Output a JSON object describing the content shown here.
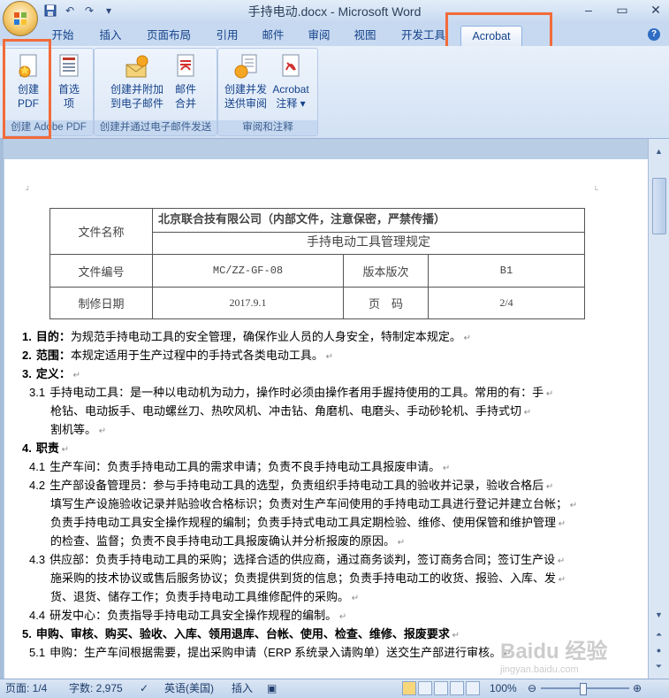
{
  "window": {
    "title": "手持电动.docx - Microsoft Word"
  },
  "quick_access": [
    "save-icon",
    "undo-icon",
    "redo-icon",
    "customize-icon"
  ],
  "tabs": [
    {
      "label": "开始"
    },
    {
      "label": "插入"
    },
    {
      "label": "页面布局"
    },
    {
      "label": "引用"
    },
    {
      "label": "邮件"
    },
    {
      "label": "审阅"
    },
    {
      "label": "视图"
    },
    {
      "label": "开发工具"
    },
    {
      "label": "Acrobat",
      "active": true
    }
  ],
  "ribbon": {
    "groups": [
      {
        "label": "创建 Adobe PDF",
        "buttons": [
          {
            "label1": "创建",
            "label2": "PDF"
          },
          {
            "label1": "首选",
            "label2": "项"
          }
        ]
      },
      {
        "label": "创建并通过电子邮件发送",
        "buttons": [
          {
            "label1": "创建并附加",
            "label2": "到电子邮件"
          },
          {
            "label1": "邮件",
            "label2": "合并"
          }
        ]
      },
      {
        "label": "审阅和注释",
        "buttons": [
          {
            "label1": "创建并发",
            "label2": "送供审阅"
          },
          {
            "label1": "Acrobat",
            "label2": "注释 ▾"
          }
        ]
      }
    ]
  },
  "doc": {
    "header_table": {
      "file_name_label": "文件名称",
      "company": "北京联合技有限公司（内部文件，注意保密，严禁传播）",
      "doc_title": "手持电动工具管理规定",
      "file_no_label": "文件编号",
      "file_no": "MC/ZZ-GF-08",
      "version_label": "版本版次",
      "version": "B1",
      "date_label": "制修日期",
      "date": "2017.9.1",
      "page_label": "页　码",
      "page": "2/4"
    },
    "lines": [
      {
        "num": "1.",
        "head": "目的：",
        "text": "为规范手持电动工具的安全管理，确保作业人员的人身安全，特制定本规定。"
      },
      {
        "num": "2.",
        "head": "范围：",
        "text": "本规定适用于生产过程中的手持式各类电动工具。"
      },
      {
        "num": "3.",
        "head": "定义：",
        "text": ""
      },
      {
        "num": "3.1",
        "head": "",
        "text": "手持电动工具：是一种以电动机为动力，操作时必须由操作者用手握持使用的工具。常用的有：手"
      },
      {
        "num": "",
        "head": "",
        "text": "枪钻、电动扳手、电动螺丝刀、热吹风机、冲击钻、角磨机、电磨头、手动砂轮机、手持式切"
      },
      {
        "num": "",
        "head": "",
        "text": "割机等。"
      },
      {
        "num": "4.",
        "head": "职责",
        "text": ""
      },
      {
        "num": "4.1",
        "head": "",
        "text": "生产车间：负责手持电动工具的需求申请；负责不良手持电动工具报废申请。"
      },
      {
        "num": "4.2",
        "head": "",
        "text": "生产部设备管理员：参与手持电动工具的选型，负责组织手持电动工具的验收并记录，验收合格后"
      },
      {
        "num": "",
        "head": "",
        "text": "填写生产设施验收记录并贴验收合格标识；负责对生产车间使用的手持电动工具进行登记并建立台帐；"
      },
      {
        "num": "",
        "head": "",
        "text": "负责手持电动工具安全操作规程的编制；负责手持式电动工具定期检验、维修、使用保管和维护管理"
      },
      {
        "num": "",
        "head": "",
        "text": "的检查、监督；负责不良手持电动工具报废确认并分析报废的原因。"
      },
      {
        "num": "4.3",
        "head": "",
        "text": "供应部：负责手持电动工具的采购；选择合适的供应商，通过商务谈判，签订商务合同；签订生产设"
      },
      {
        "num": "",
        "head": "",
        "text": "施采购的技术协议或售后服务协议；负责提供到货的信息；负责手持电动工的收货、报验、入库、发"
      },
      {
        "num": "",
        "head": "",
        "text": "货、退货、储存工作；负责手持电动工具维修配件的采购。"
      },
      {
        "num": "4.4",
        "head": "",
        "text": "研发中心：负责指导手持电动工具安全操作规程的编制。"
      },
      {
        "num": "5.",
        "head": "申购、审核、购买、验收、入库、领用退库、台帐、使用、检查、维修、报废要求",
        "text": ""
      },
      {
        "num": "5.1",
        "head": "",
        "text": "申购：生产车间根据需要，提出采购申请（ERP 系统录入请购单）送交生产部进行审核。"
      }
    ]
  },
  "status": {
    "page": "页面: 1/4",
    "words": "字数: 2,975",
    "language": "英语(美国)",
    "mode": "插入",
    "zoom": "100%"
  },
  "watermark": "Baidu 经验",
  "watermark_url": "jingyan.baidu.com",
  "colors": {
    "highlight": "#f26b3a",
    "tab_text": "#15428b",
    "ribbon_bg": "#dbe7f6"
  }
}
